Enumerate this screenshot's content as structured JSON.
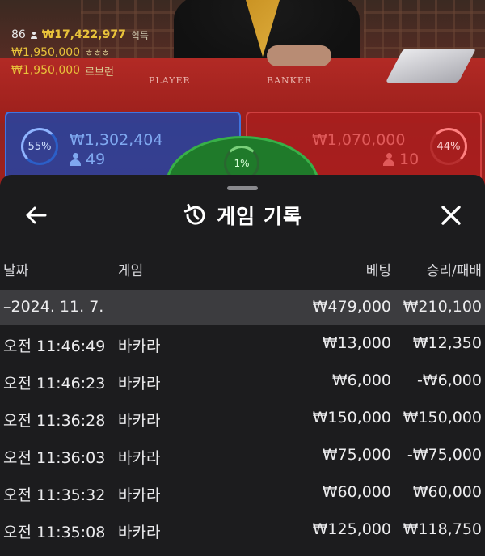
{
  "game": {
    "balance_prefix": "86",
    "winnings": "₩17,422,977",
    "winnings_label": "획득",
    "ticker": [
      {
        "amount": "₩1,950,000",
        "name": "ㅎㅎㅎ"
      },
      {
        "amount": "₩1,950,000",
        "name": "르브런"
      }
    ],
    "felt_player": "PLAYER",
    "felt_banker": "BANKER",
    "player": {
      "percent": "55%",
      "amount": "₩1,302,404",
      "players": "49"
    },
    "banker": {
      "percent": "44%",
      "amount": "₩1,070,000",
      "players": "10"
    },
    "tie": {
      "percent": "1%"
    },
    "colors": {
      "player": "#3f74e0",
      "banker": "#d04040",
      "tie": "#38b048",
      "gold": "#e8c23a"
    }
  },
  "sheet": {
    "title": "게임 기록",
    "icons": {
      "back": "arrow-left-icon",
      "history": "history-icon",
      "close": "close-icon"
    },
    "columns": {
      "date": "날짜",
      "game": "게임",
      "bet": "베팅",
      "win": "승리/패배"
    },
    "summary": {
      "date": "–2024. 11. 7.",
      "bet": "₩479,000",
      "win": "₩210,100"
    },
    "rows": [
      {
        "time": "오전 11:46:49",
        "game": "바카라",
        "bet": "₩13,000",
        "win": "₩12,350"
      },
      {
        "time": "오전 11:46:23",
        "game": "바카라",
        "bet": "₩6,000",
        "win": "-₩6,000"
      },
      {
        "time": "오전 11:36:28",
        "game": "바카라",
        "bet": "₩150,000",
        "win": "₩150,000"
      },
      {
        "time": "오전 11:36:03",
        "game": "바카라",
        "bet": "₩75,000",
        "win": "-₩75,000"
      },
      {
        "time": "오전 11:35:32",
        "game": "바카라",
        "bet": "₩60,000",
        "win": "₩60,000"
      },
      {
        "time": "오전 11:35:08",
        "game": "바카라",
        "bet": "₩125,000",
        "win": "₩118,750"
      }
    ]
  }
}
